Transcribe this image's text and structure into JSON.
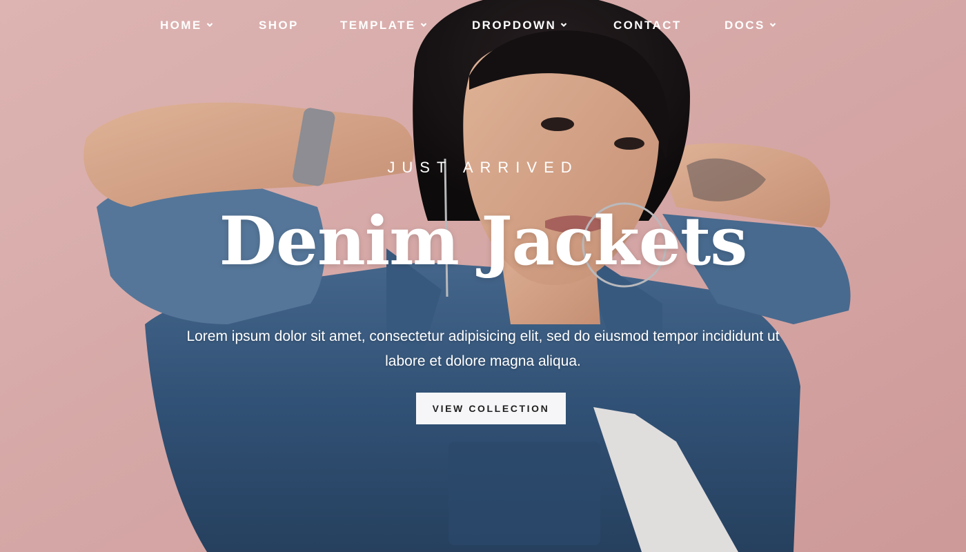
{
  "nav": {
    "items": [
      {
        "label": "HOME",
        "has_dropdown": true
      },
      {
        "label": "SHOP",
        "has_dropdown": false
      },
      {
        "label": "TEMPLATE",
        "has_dropdown": true
      },
      {
        "label": "DROPDOWN",
        "has_dropdown": true
      },
      {
        "label": "CONTACT",
        "has_dropdown": false
      },
      {
        "label": "DOCS",
        "has_dropdown": true
      }
    ]
  },
  "hero": {
    "eyebrow": "JUST ARRIVED",
    "title": "Denim Jackets",
    "description": "Lorem ipsum dolor sit amet, consectetur adipisicing elit, sed do eiusmod tempor incididunt ut labore et dolore magna aliqua.",
    "cta_label": "VIEW COLLECTION"
  },
  "colors": {
    "background_wall": "#e9b9b8",
    "text": "#ffffff",
    "cta_bg": "#f6f6f8",
    "cta_text": "#1f1f1f",
    "denim": "#35587f"
  },
  "icons": {
    "dropdown": "chevron-down-icon"
  }
}
